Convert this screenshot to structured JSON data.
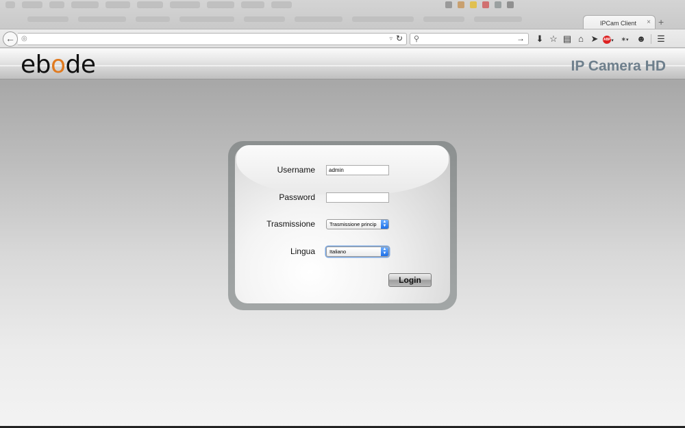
{
  "browser": {
    "tab_title": "IPCam Client",
    "tab_close": "×",
    "new_tab": "+",
    "url": "",
    "search_placeholder": "",
    "icons": [
      "back-icon",
      "globe-icon",
      "reload-icon",
      "search-icon",
      "go-arrow-icon",
      "download-icon",
      "bookmark-star-icon",
      "reading-list-icon",
      "home-icon",
      "send-icon",
      "adblock-icon",
      "extension-icon",
      "chat-icon",
      "menu-icon"
    ]
  },
  "header": {
    "logo_prefix": "eb",
    "logo_o": "o",
    "logo_suffix": "de",
    "title": "IP Camera HD"
  },
  "login": {
    "username_label": "Username",
    "username_value": "admin",
    "password_label": "Password",
    "password_value": "",
    "transmission_label": "Trasmissione",
    "transmission_value": "Trasmissione princip",
    "language_label": "Lingua",
    "language_value": "Italiano",
    "login_button": "Login"
  },
  "colors": {
    "logo_accent": "#e07a1f",
    "title": "#6e7f8c",
    "select_arrow": "#1c6fe8"
  }
}
